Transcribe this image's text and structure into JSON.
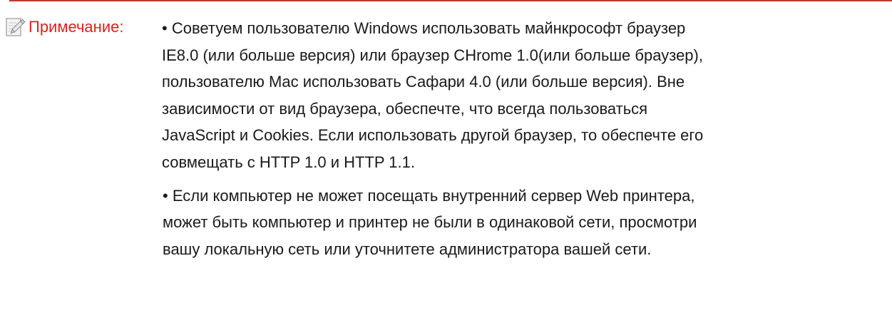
{
  "colors": {
    "rule": "#c0392b",
    "label": "#e0201c",
    "text": "#1a1a1a"
  },
  "note": {
    "icon": "note-pencil-icon",
    "label": "Примечание:",
    "paragraphs": [
      "• Советуем пользователю Windows использовать майнкрософт браузер\nIE8.0 (или больше версия) или браузер CHrome 1.0(или больше браузер),\nпользователю Mac использовать Сафари 4.0 (или больше версия). Вне\nзависимости от вид браузера, обеспечте, что всегда пользоваться\nJavaScript и Cookies. Если использовать другой браузер, то обеспечте его\nсовмещать с HTTP 1.0 и HTTP 1.1.",
      "• Если компьютер не может посещать внутренний сервер Web принтера,\nможет быть компьютер и принтер не были в одинаковой сети, просмотри\nвашу локальную сеть или уточнитете администратора вашей сети."
    ]
  }
}
